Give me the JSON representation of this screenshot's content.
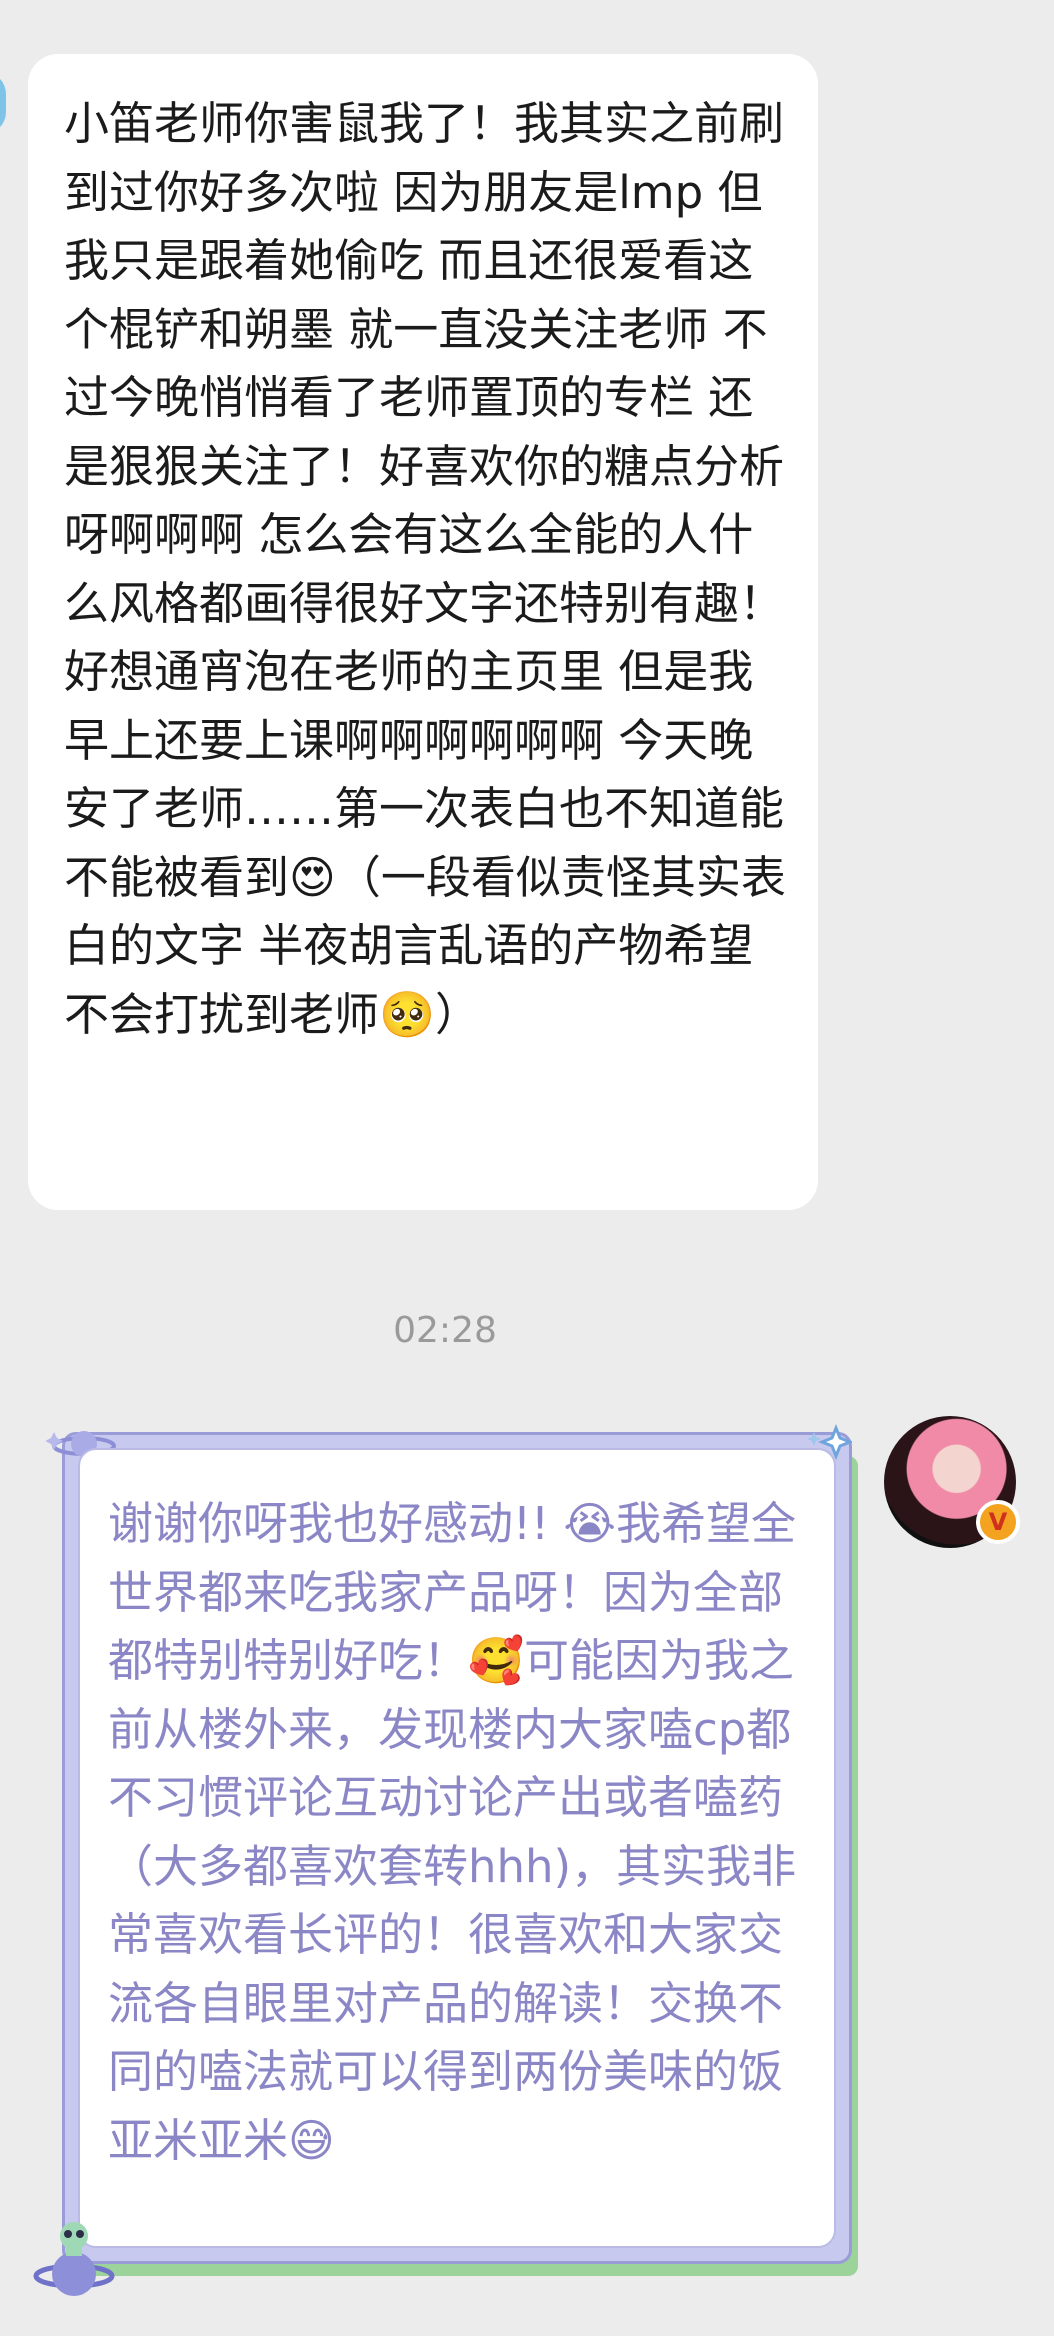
{
  "chat": {
    "incoming_message": {
      "text": "小笛老师你害鼠我了！我其实之前刷到过你好多次啦 因为朋友是lmp 但我只是跟着她偷吃 而且还很爱看这个棍铲和朔墨 就一直没关注老师 不过今晚悄悄看了老师置顶的专栏 还是狠狠关注了！好喜欢你的糖点分析呀啊啊啊 怎么会有这么全能的人什么风格都画得很好文字还特别有趣！好想通宵泡在老师的主页里 但是我早上还要上课啊啊啊啊啊啊 今天晚安了老师……第一次表白也不知道能不能被看到😍（一段看似责怪其实表白的文字 半夜胡言乱语的产物希望不会打扰到老师🥺）"
    },
    "timestamp": "02:28",
    "outgoing_message": {
      "text": "谢谢你呀我也好感动!! 😭我希望全世界都来吃我家产品呀！因为全部都特别特别好吃！🥰可能因为我之前从楼外来，发现楼内大家嗑cp都不习惯评论互动讨论产出或者嗑药（大多都喜欢套转hhh)，其实我非常喜欢看长评的！很喜欢和大家交流各自眼里对产品的解读！交换不同的嗑法就可以得到两份美味的饭亚米亚米😅"
    },
    "avatar": {
      "icon": "avatar-image",
      "badge_icon": "verified-v-badge-icon",
      "badge_text": "V"
    },
    "colors": {
      "background": "#ececec",
      "incoming_bubble": "#ffffff",
      "outgoing_text": "#8b87c6",
      "card_frame": "#c8c9ee",
      "card_shadow": "#9bd39a"
    }
  }
}
